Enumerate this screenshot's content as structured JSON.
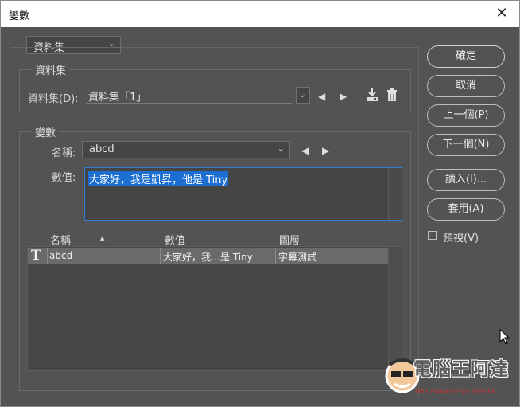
{
  "window": {
    "title": "變數",
    "close_glyph": "✕"
  },
  "top_dropdown": {
    "value": "資料集"
  },
  "dataset_group": {
    "legend": "資料集",
    "field_label": "資料集(D):",
    "field_value": "資料集「1」"
  },
  "variable_group": {
    "legend": "變數",
    "name_label": "名稱:",
    "name_value": "abcd",
    "value_label": "數值:",
    "value_text": "大家好，我是凱昇，他是 Tiny"
  },
  "table": {
    "headers": [
      "名稱",
      "數值",
      "圖層"
    ],
    "sort_glyph": "▲",
    "rows": [
      {
        "type_icon": "T",
        "name": "abcd",
        "value": "大家好，我…是 Tiny",
        "layer": "字幕測試"
      }
    ]
  },
  "buttons": {
    "ok": "確定",
    "cancel": "取消",
    "prev": "上一個(P)",
    "next": "下一個(N)",
    "import": "讀入(I)...",
    "apply": "套用(A)"
  },
  "preview": {
    "label": "預視(V)",
    "checked": false
  },
  "icons": {
    "chevron": "⌄",
    "left": "◀",
    "right": "▶",
    "trash": "🗑"
  },
  "watermark": {
    "text": "電腦王阿達",
    "url": "http://www.kocpc.com.tw"
  }
}
